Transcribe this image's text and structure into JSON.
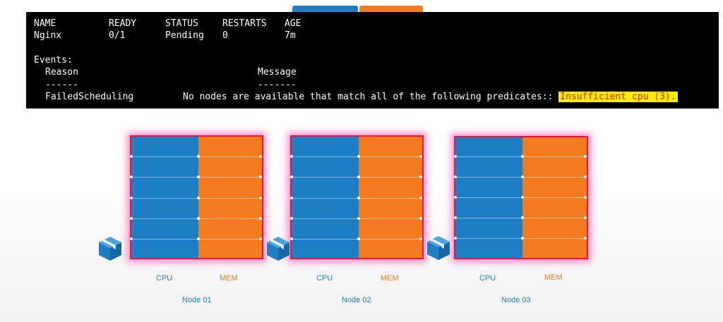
{
  "terminal": {
    "headers": {
      "name": "NAME",
      "ready": "READY",
      "status": "STATUS",
      "restarts": "RESTARTS",
      "age": "AGE"
    },
    "row": {
      "name": "Nginx",
      "ready": "0/1",
      "status": "Pending",
      "restarts": "0",
      "age": "7m"
    },
    "events_label": "Events:",
    "reason_header": "Reason",
    "message_header": "Message",
    "reason_sep": "------",
    "message_sep": "-------",
    "event_reason": "FailedScheduling",
    "event_message": "No nodes are available that match all of the following predicates::",
    "event_highlight": "Insufficient cpu (3)."
  },
  "nodes": [
    {
      "name": "Node 01",
      "cpu_label": "CPU",
      "mem_label": "MEM"
    },
    {
      "name": "Node 02",
      "cpu_label": "CPU",
      "mem_label": "MEM"
    },
    {
      "name": "Node 03",
      "cpu_label": "CPU",
      "mem_label": "MEM"
    }
  ],
  "colors": {
    "cpu": "#1e7fc5",
    "mem": "#f47b20",
    "highlight_bg": "#ffee00",
    "highlight_text": "#e0201a",
    "node_border": "#e8143c"
  },
  "icons": {
    "node": "cube-icon"
  }
}
